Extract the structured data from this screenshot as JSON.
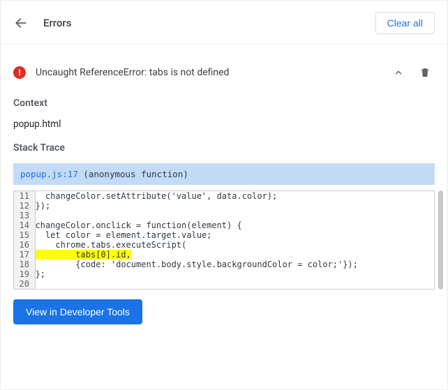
{
  "header": {
    "title": "Errors",
    "clear_all": "Clear all"
  },
  "error": {
    "message": "Uncaught ReferenceError: tabs is not defined"
  },
  "sections": {
    "context_label": "Context",
    "context_value": "popup.html",
    "stack_trace_label": "Stack Trace"
  },
  "trace": {
    "file": "popup.js:17",
    "func": "(anonymous function)"
  },
  "code": {
    "lines": [
      {
        "n": 11,
        "t": "  changeColor.setAttribute('value', data.color);"
      },
      {
        "n": 12,
        "t": "});"
      },
      {
        "n": 13,
        "t": ""
      },
      {
        "n": 14,
        "t": "changeColor.onclick = function(element) {"
      },
      {
        "n": 15,
        "t": "  let color = element.target.value;"
      },
      {
        "n": 16,
        "t": "    chrome.tabs.executeScript("
      },
      {
        "n": 17,
        "t": "        tabs[0].id,",
        "hl": true
      },
      {
        "n": 18,
        "t": "        {code: 'document.body.style.backgroundColor = color;'});"
      },
      {
        "n": 19,
        "t": "};"
      },
      {
        "n": 20,
        "t": ""
      }
    ]
  },
  "footer": {
    "view_devtools": "View in Developer Tools"
  }
}
